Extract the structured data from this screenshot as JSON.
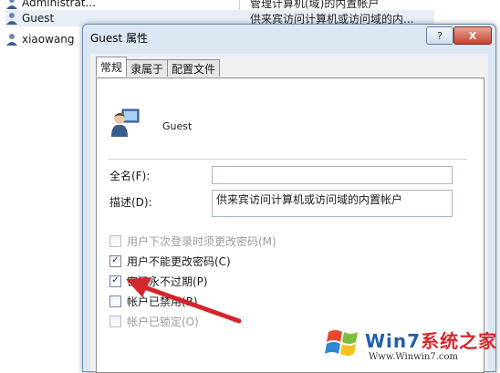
{
  "background_list": {
    "rows": [
      {
        "name": "Administrat...",
        "description": "管理计算机(域)的内置帐户"
      },
      {
        "name": "Guest",
        "description": "供来宾访问计算机或访问域的内..."
      },
      {
        "name": "xiaowang",
        "description": ""
      }
    ]
  },
  "dialog": {
    "title": "Guest 属性",
    "help_button": "?",
    "close_button": "X",
    "tabs": [
      "常规",
      "隶属于",
      "配置文件"
    ],
    "user_display_name": "Guest",
    "fullname_label": "全名(F):",
    "fullname_value": "",
    "description_label": "描述(D):",
    "description_value": "供来宾访问计算机或访问域的内置帐户",
    "options": [
      {
        "label": "用户下次登录时须更改密码(M)",
        "checked": false,
        "enabled": false
      },
      {
        "label": "用户不能更改密码(C)",
        "checked": true,
        "enabled": true
      },
      {
        "label": "密码永不过期(P)",
        "checked": true,
        "enabled": true
      },
      {
        "label": "帐户已禁用(B)",
        "checked": false,
        "enabled": true
      },
      {
        "label": "帐户已锁定(O)",
        "checked": false,
        "enabled": false
      }
    ]
  },
  "watermark": {
    "title_prefix": "Win7",
    "title_suffix": "系统之家",
    "url": "Www.Winwin7.com"
  },
  "colors": {
    "arrow": "#d3262c",
    "title_bg": "#dce7f4",
    "brand_red": "#d9272e",
    "brand_blue": "#1f5fb0"
  }
}
